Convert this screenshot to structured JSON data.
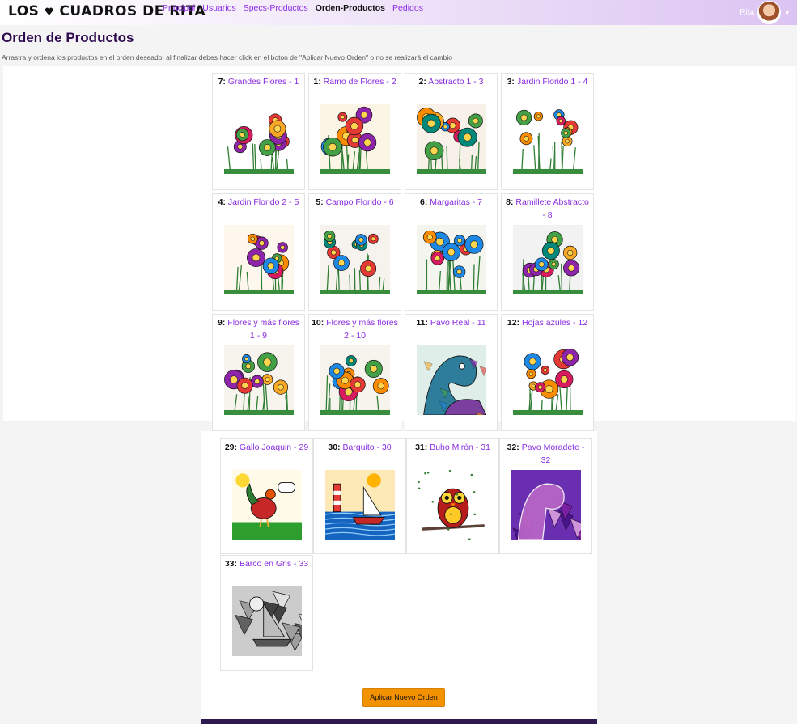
{
  "brand": {
    "part1": "LOS",
    "heart": "♥",
    "part2": "CUADROS DE RITA"
  },
  "nav": [
    {
      "label": "Principal",
      "active": false
    },
    {
      "label": "Usuarios",
      "active": false
    },
    {
      "label": "Specs-Productos",
      "active": false
    },
    {
      "label": "Orden-Productos",
      "active": true
    },
    {
      "label": "Pedidos",
      "active": false
    }
  ],
  "user": {
    "name": "Rita"
  },
  "page": {
    "title": "Orden de Productos",
    "description": "Arrastra y ordena los productos en el orden deseado, al finalizar debes hacer click en el boton de \"Aplicar Nuevo Orden\" o no se realizará el cambio"
  },
  "top_products": [
    {
      "num": "7:",
      "name": "Grandes Flores - 1",
      "theme": "flowers",
      "bg": "#ffffff"
    },
    {
      "num": "1:",
      "name": "Ramo de Flores - 2",
      "theme": "flowers",
      "bg": "#fbf5e6"
    },
    {
      "num": "2:",
      "name": "Abstracto 1 - 3",
      "theme": "flowers",
      "bg": "#f7f1ea"
    },
    {
      "num": "3:",
      "name": "Jardin Florido 1 - 4",
      "theme": "flowers",
      "bg": "#ffffff"
    },
    {
      "num": "4:",
      "name": "Jardin Florido 2 - 5",
      "theme": "flowers",
      "bg": "#fdf7ee"
    },
    {
      "num": "5:",
      "name": "Campo Florido - 6",
      "theme": "flowers",
      "bg": "#f6f3ee"
    },
    {
      "num": "6:",
      "name": "Margaritas - 7",
      "theme": "flowers",
      "bg": "#f5f5f0"
    },
    {
      "num": "8:",
      "name": "Ramillete Abstracto - 8",
      "theme": "flowers",
      "bg": "#f2f2f2"
    },
    {
      "num": "9:",
      "name": "Flores y más flores 1 - 9",
      "theme": "flowers",
      "bg": "#f7f4ee"
    },
    {
      "num": "10:",
      "name": "Flores y más flores 2 - 10",
      "theme": "flowers",
      "bg": "#f7f4ee"
    },
    {
      "num": "11:",
      "name": "Pavo Real - 11",
      "theme": "peacock",
      "bg": "#dfeee9"
    },
    {
      "num": "12:",
      "name": "Hojas azules - 12",
      "theme": "flowers",
      "bg": "#ffffff"
    }
  ],
  "bottom_products": [
    {
      "num": "29:",
      "name": "Gallo Joaquin - 29",
      "theme": "rooster",
      "bg": "#fffbe8"
    },
    {
      "num": "30:",
      "name": "Barquito - 30",
      "theme": "boat",
      "bg": "#fde9b5"
    },
    {
      "num": "31:",
      "name": "Buho Mirón - 31",
      "theme": "owl",
      "bg": "#ffffff"
    },
    {
      "num": "32:",
      "name": "Pavo Moradete - 32",
      "theme": "purple",
      "bg": "#6a2fb0"
    },
    {
      "num": "33:",
      "name": "Barco en Gris - 33",
      "theme": "gray",
      "bg": "#cccccc"
    }
  ],
  "apply_button": "Aplicar Nuevo Orden",
  "colors": {
    "accent": "#8a2be2",
    "button": "#f39200",
    "title": "#2e0a4f"
  }
}
